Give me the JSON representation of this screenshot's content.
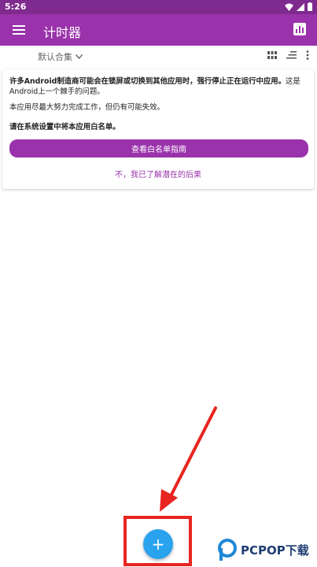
{
  "status_bar": {
    "time": "5:26"
  },
  "app_bar": {
    "title": "计时器"
  },
  "toolbar": {
    "collection_label": "默认合集"
  },
  "card": {
    "warning_bold": "许多Android制造商可能会在锁屏或切换到其他应用时，强行停止正在运行中应用。",
    "warning_rest": "这是Android上一个棘手的问题。",
    "best_effort": "本应用尽最大努力完成工作，但仍有可能失效。",
    "instruction": "请在系统设置中将本应用白名单。",
    "guide_button": "查看白名单指南",
    "ignore_link": "不，我已了解潜在的后果"
  },
  "fab": {
    "label": "+"
  },
  "watermark": {
    "text": "PCPOP下载"
  },
  "colors": {
    "primary": "#9a32ab",
    "status_bar": "#7f2a8e",
    "fab": "#29a3ee",
    "annotation": "#e8251f"
  }
}
